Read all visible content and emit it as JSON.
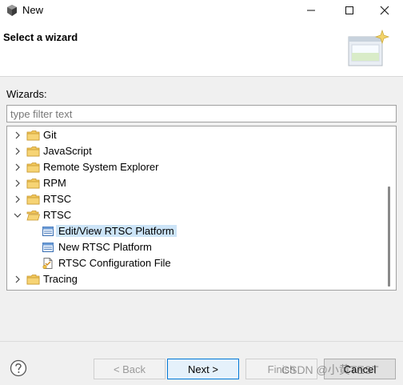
{
  "window": {
    "title": "New",
    "minimize_glyph": "—",
    "maximize_glyph": "☐",
    "close_glyph": "✕"
  },
  "header": {
    "title": "Select a wizard",
    "banner_icon": "wizard-banner-icon"
  },
  "wizards": {
    "label": "Wizards:",
    "filter_placeholder": "type filter text",
    "filter_value": "",
    "items": [
      {
        "label": "Git",
        "type": "folder",
        "expanded": false,
        "level": 0
      },
      {
        "label": "JavaScript",
        "type": "folder",
        "expanded": false,
        "level": 0
      },
      {
        "label": "Remote System Explorer",
        "type": "folder",
        "expanded": false,
        "level": 0
      },
      {
        "label": "RPM",
        "type": "folder",
        "expanded": false,
        "level": 0
      },
      {
        "label": "RTSC",
        "type": "folder",
        "expanded": false,
        "level": 0
      },
      {
        "label": "RTSC",
        "type": "folder",
        "expanded": true,
        "level": 0
      },
      {
        "label": "Edit/View RTSC Platform",
        "type": "file",
        "selected": true,
        "level": 1
      },
      {
        "label": "New RTSC Platform",
        "type": "file",
        "selected": false,
        "level": 1
      },
      {
        "label": "RTSC Configuration File",
        "type": "config-file",
        "selected": false,
        "level": 1
      },
      {
        "label": "Tracing",
        "type": "folder",
        "expanded": false,
        "level": 0
      }
    ]
  },
  "footer": {
    "help_icon": "help-icon",
    "back_label": "< Back",
    "next_label": "Next >",
    "finish_label": "Finish",
    "cancel_label": "Cancel"
  },
  "watermark": "CSDN @小黄TEST",
  "colors": {
    "selection": "#cce4f7",
    "folder": "#e8b84a",
    "accent": "#0078d7"
  }
}
